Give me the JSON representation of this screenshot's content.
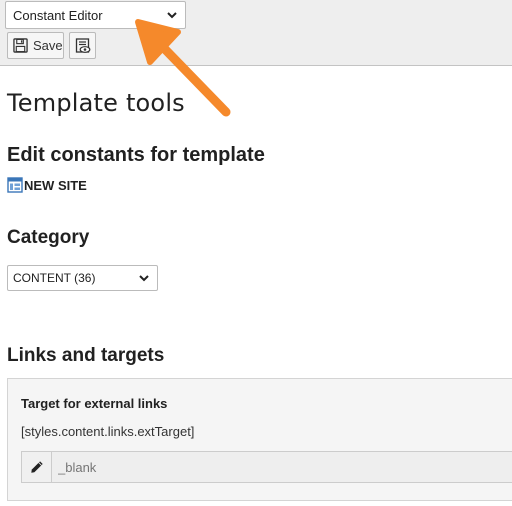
{
  "toolbar": {
    "function_select": "Constant Editor",
    "save_label": "Save",
    "save_icon": "save-icon",
    "view_icon": "view-page-icon"
  },
  "page": {
    "title": "Template tools",
    "subtitle": "Edit constants for template",
    "site_name": "NEW SITE",
    "site_icon": "template-icon"
  },
  "category": {
    "heading": "Category",
    "selected": "CONTENT (36)"
  },
  "section": {
    "heading": "Links and targets",
    "field": {
      "title": "Target for external links",
      "key": "[styles.content.links.extTarget]",
      "placeholder": "_blank",
      "edit_icon": "pencil-icon"
    }
  },
  "annotation": {
    "color": "#f5892b"
  }
}
